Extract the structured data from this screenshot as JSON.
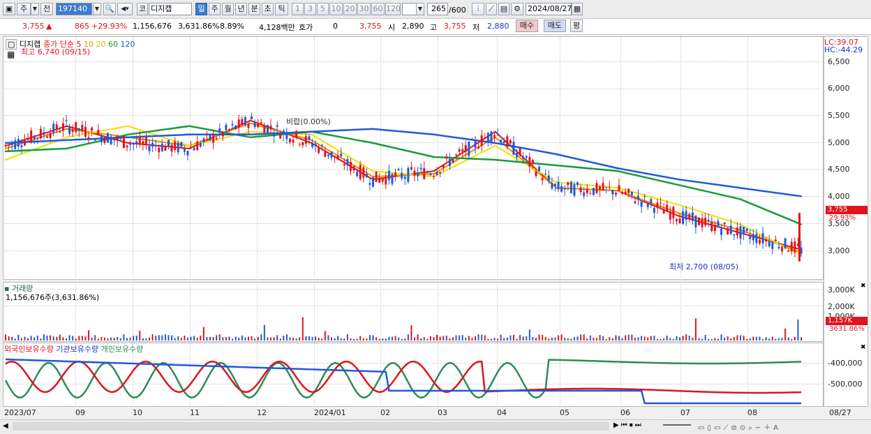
{
  "toolbar": {
    "period_type": "주",
    "prev_label": "전",
    "code_value": "197140",
    "market_label": "코",
    "stock_name": "디지캡",
    "periods": [
      "일",
      "주",
      "월",
      "년",
      "분",
      "초",
      "틱"
    ],
    "selected_period": "일",
    "intervals": [
      "1",
      "3",
      "5",
      "10",
      "20",
      "30",
      "60",
      "120"
    ],
    "count_value": "265",
    "count_total": "/600",
    "date_value": "2024/08/27"
  },
  "quote": {
    "price": "3,755",
    "change": "865",
    "change_rate": "+29.93%",
    "volume": "1,156,676",
    "volume_rate": "3,631.86%",
    "turnover": "8.89%",
    "amount": "4,128백만",
    "hoga_label": "호가",
    "hoga_value": "0",
    "hoga_price": "3,755",
    "open_label": "시",
    "open": "2,890",
    "high_label": "고",
    "high": "3,755",
    "low_label": "저",
    "low": "2,880",
    "buy_label": "매수",
    "sell_label": "매도",
    "eval_label": "평"
  },
  "price_panel": {
    "name_tag": "디지캡",
    "legend_close": "종가 단순",
    "ma_labels": [
      "5",
      "10",
      "20",
      "60",
      "120"
    ],
    "ma_colors": [
      "#e0141e",
      "#f08c00",
      "#f0e000",
      "#1a9a3a",
      "#1f5ad8"
    ],
    "high_note": "최고 6,740 (09/15)",
    "low_note": "최저 2,700 (08/05)",
    "mid_note": "비랍(0.00%)",
    "lc": "LC:39.07",
    "hc": "HC:-44.29",
    "price_badge": "3,755",
    "rate_badge": "29.93%",
    "y_ticks": [
      "6,500",
      "6,000",
      "5,500",
      "5,000",
      "4,500",
      "4,000",
      "3,500",
      "3,000"
    ]
  },
  "volume_panel": {
    "title": "거래량",
    "value_note": "1,156,676주(3,631.86%)",
    "y_ticks": [
      "3,000K",
      "2,000K",
      "1,000K"
    ],
    "badge": "1,157K",
    "badge_rate": "3631.86%"
  },
  "holding_panel": {
    "legend": [
      "외국인보유수량",
      "기관보유수량",
      "개인보유수량"
    ],
    "legend_colors": [
      "#e0141e",
      "#1f5ad8",
      "#2e8a5a"
    ],
    "y_ticks": [
      "-400,000",
      "-500,000"
    ]
  },
  "x_ticks": [
    "2023/07",
    "09",
    "10",
    "11",
    "12",
    "2024/01",
    "02",
    "03",
    "04",
    "05",
    "06",
    "07",
    "08",
    "08/27"
  ],
  "chart_data": {
    "type": "line",
    "title": "",
    "ylim": [
      2600,
      6800
    ],
    "x": [
      "2023/07",
      "09",
      "10",
      "11",
      "12",
      "2024/01",
      "02",
      "03",
      "04",
      "05",
      "06",
      "07",
      "08",
      "08/27"
    ],
    "series": [
      {
        "name": "5",
        "values": [
          4950,
          5300,
          5000,
          4900,
          5400,
          5000,
          4350,
          4500,
          5200,
          4200,
          4150,
          3700,
          3400,
          3100
        ]
      },
      {
        "name": "10",
        "values": [
          4900,
          5250,
          5100,
          4950,
          5350,
          5050,
          4400,
          4450,
          5100,
          4200,
          4150,
          3750,
          3450,
          3050
        ]
      },
      {
        "name": "20",
        "values": [
          4700,
          5100,
          5300,
          4950,
          5200,
          5150,
          4500,
          4400,
          4950,
          4300,
          4200,
          3900,
          3550,
          3000
        ]
      },
      {
        "name": "60",
        "values": [
          4850,
          4900,
          5150,
          5300,
          5100,
          5200,
          5000,
          4750,
          4700,
          4600,
          4500,
          4250,
          4000,
          3550
        ]
      },
      {
        "name": "120",
        "values": [
          5000,
          5050,
          5100,
          5150,
          5150,
          5200,
          5250,
          5150,
          5000,
          4800,
          4550,
          4350,
          4200,
          4050
        ]
      }
    ]
  }
}
